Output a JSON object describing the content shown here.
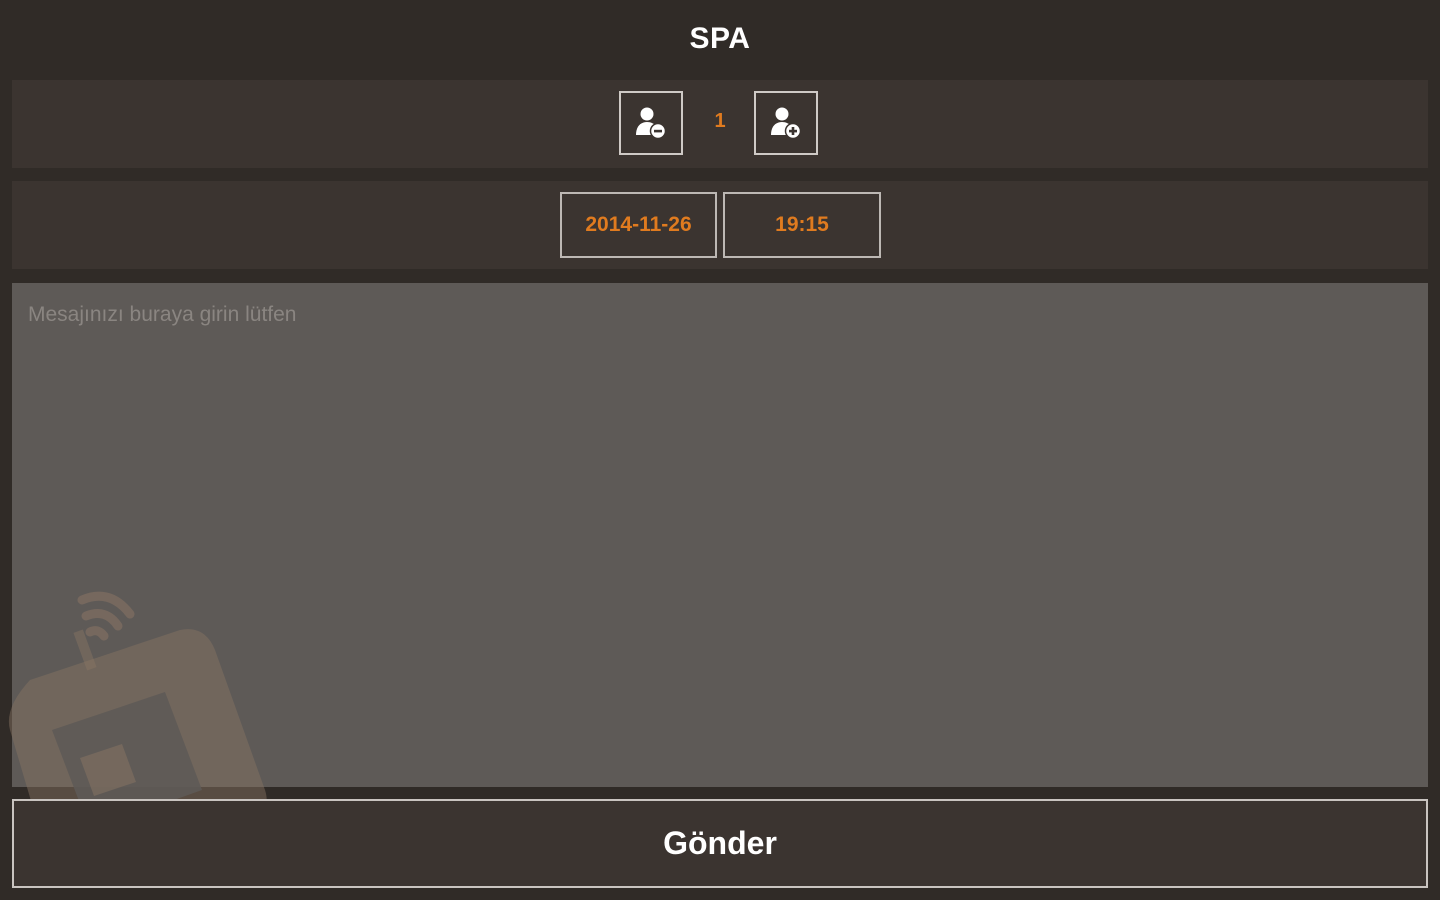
{
  "header": {
    "title": "SPA"
  },
  "guests": {
    "count": "1",
    "decrease_icon": "remove-person-icon",
    "increase_icon": "add-person-icon"
  },
  "booking": {
    "date": "2014-11-26",
    "time": "19:15"
  },
  "message": {
    "value": "",
    "placeholder": "Mesajınızı buraya girin lütfen"
  },
  "actions": {
    "send_label": "Gönder"
  },
  "colors": {
    "background": "#302b27",
    "panel": "#3b3430",
    "message_area": "#5e5a57",
    "accent": "#e07b1f",
    "text": "#ffffff"
  }
}
